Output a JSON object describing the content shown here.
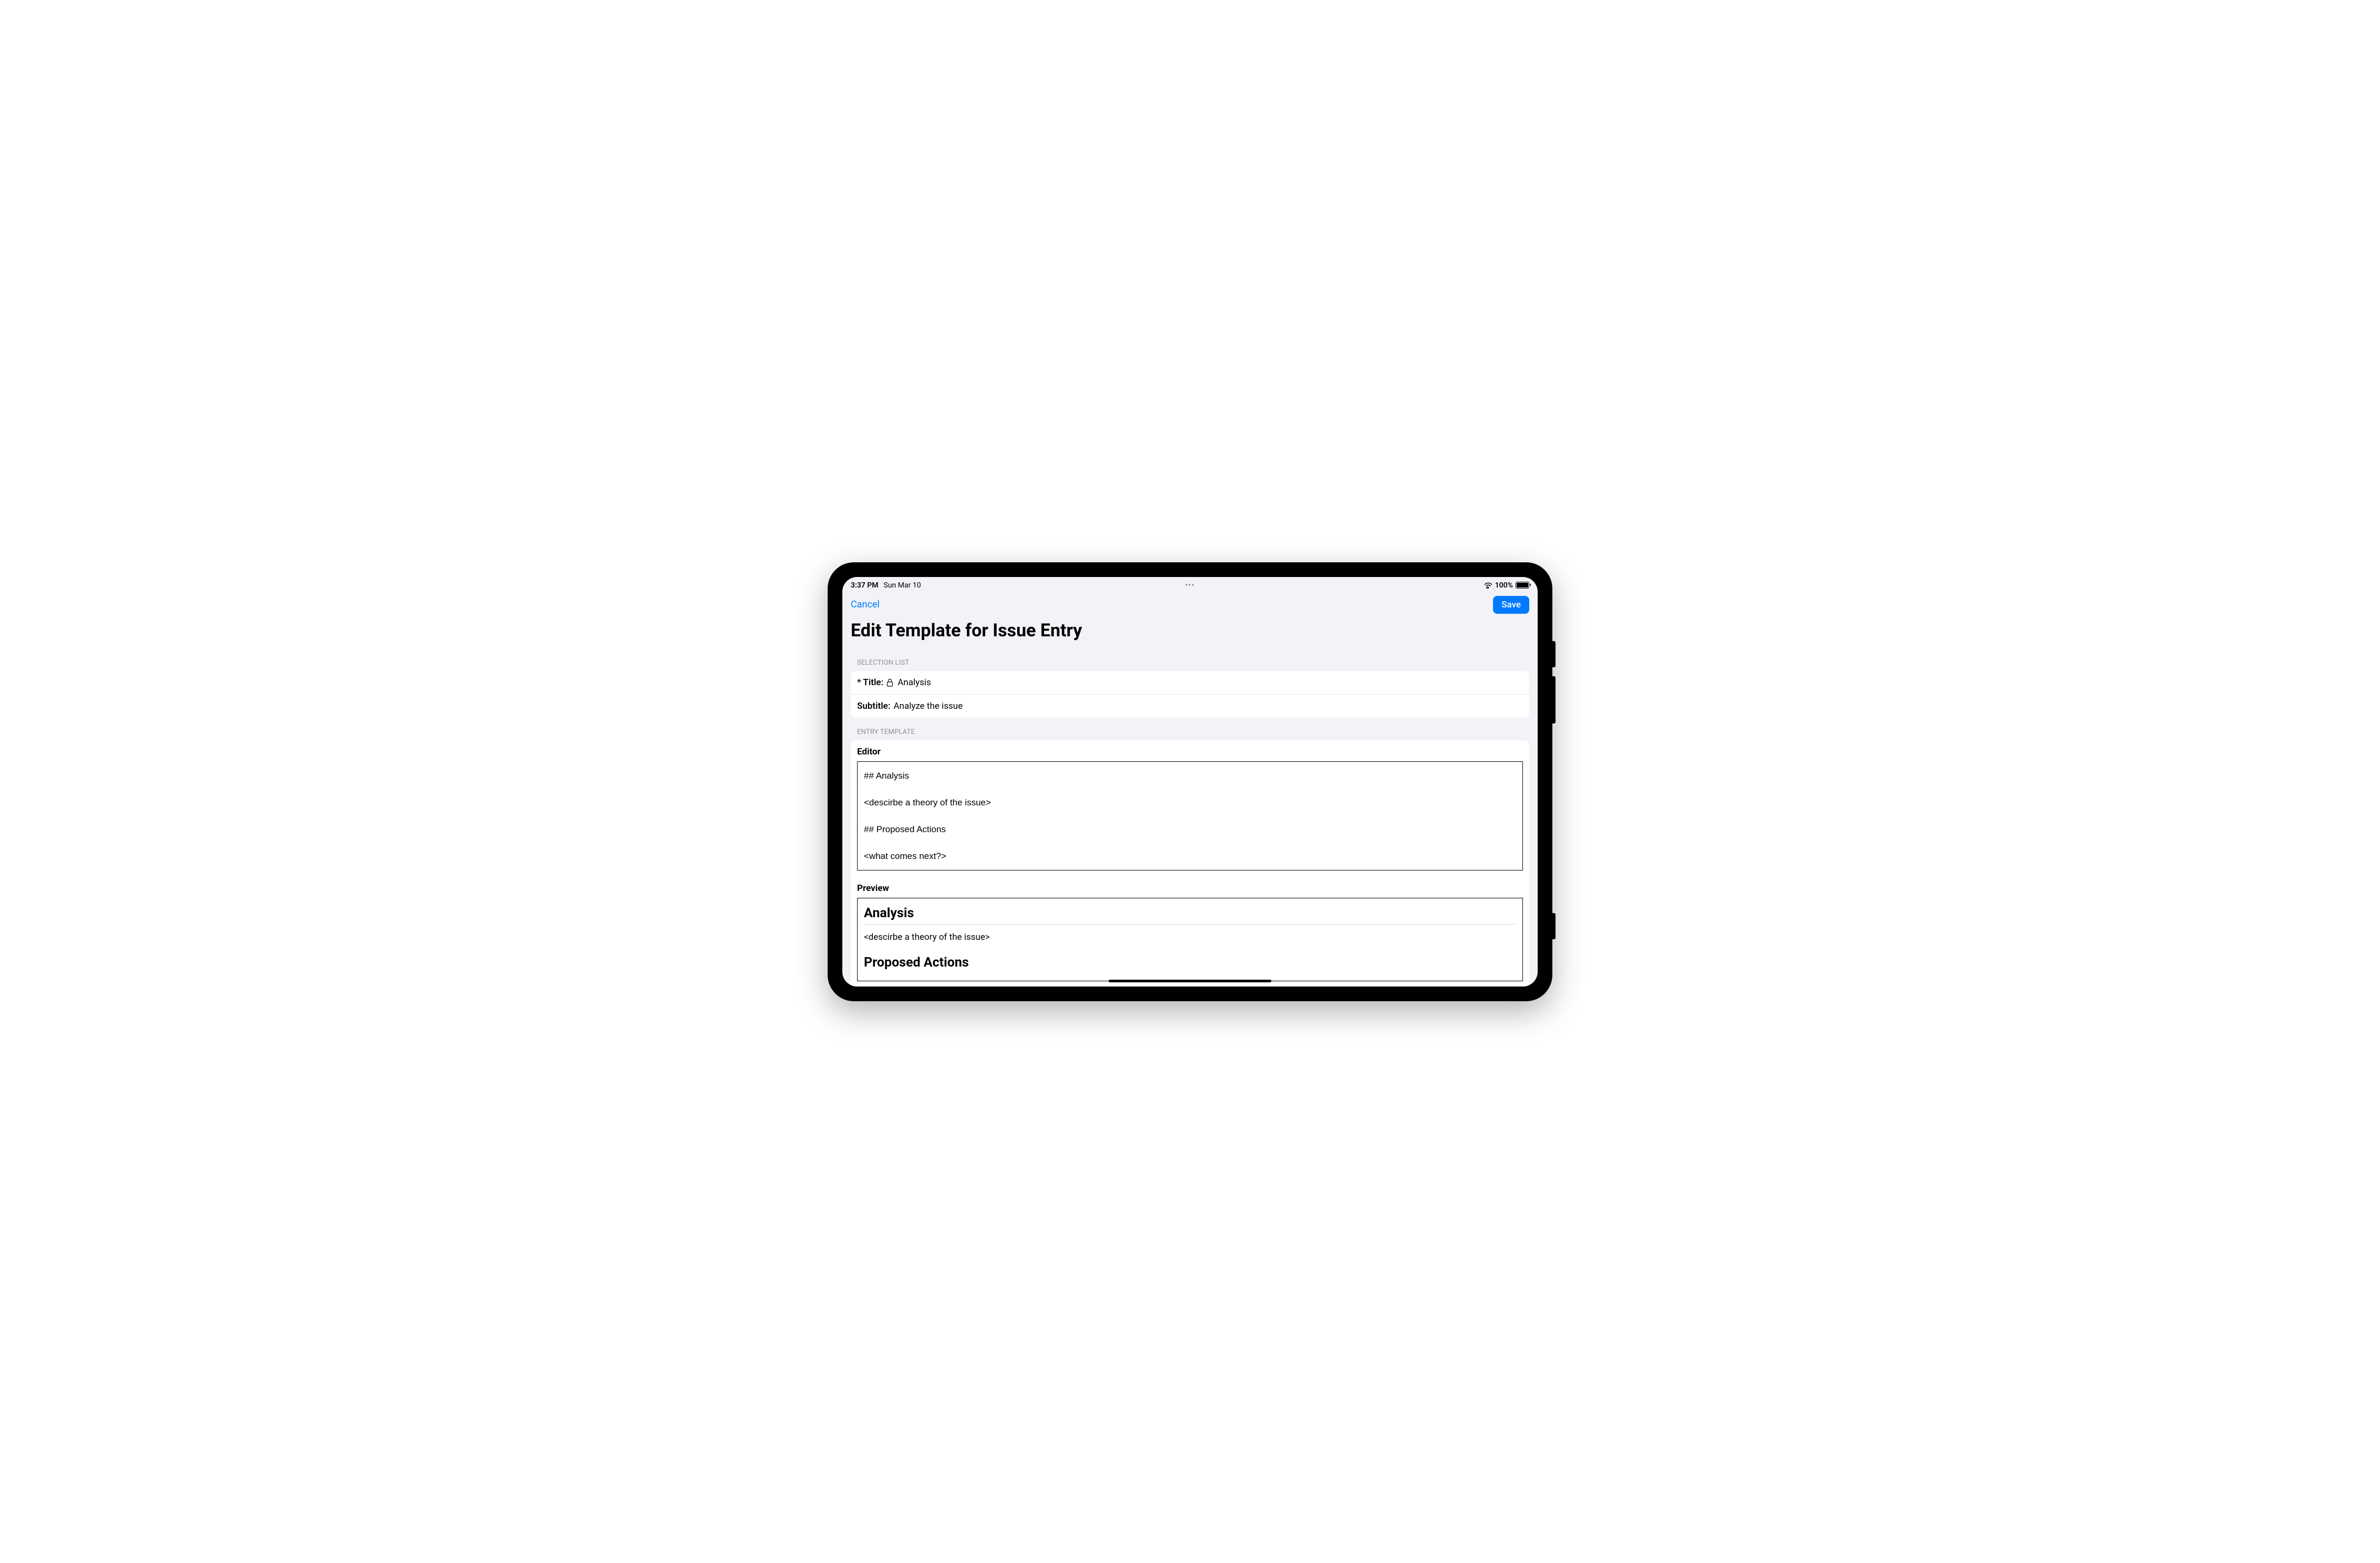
{
  "statusBar": {
    "time": "3:37 PM",
    "date": "Sun Mar 10",
    "batteryPercent": "100%"
  },
  "nav": {
    "cancel": "Cancel",
    "save": "Save"
  },
  "pageTitle": "Edit Template for Issue Entry",
  "sections": {
    "selectionList": {
      "header": "SELECTION LIST",
      "titleLabel": "* Title:",
      "titleValue": "Analysis",
      "subtitleLabel": "Subtitle:",
      "subtitleValue": "Analyze the issue"
    },
    "entryTemplate": {
      "header": "ENTRY TEMPLATE",
      "editorLabel": "Editor",
      "editorContent": "## Analysis\n\n<descirbe a theory of the issue>\n\n## Proposed Actions\n\n<what comes next?>",
      "previewLabel": "Preview",
      "preview": {
        "heading1": "Analysis",
        "body1": "<descirbe a theory of the issue>",
        "heading2": "Proposed Actions"
      }
    }
  }
}
